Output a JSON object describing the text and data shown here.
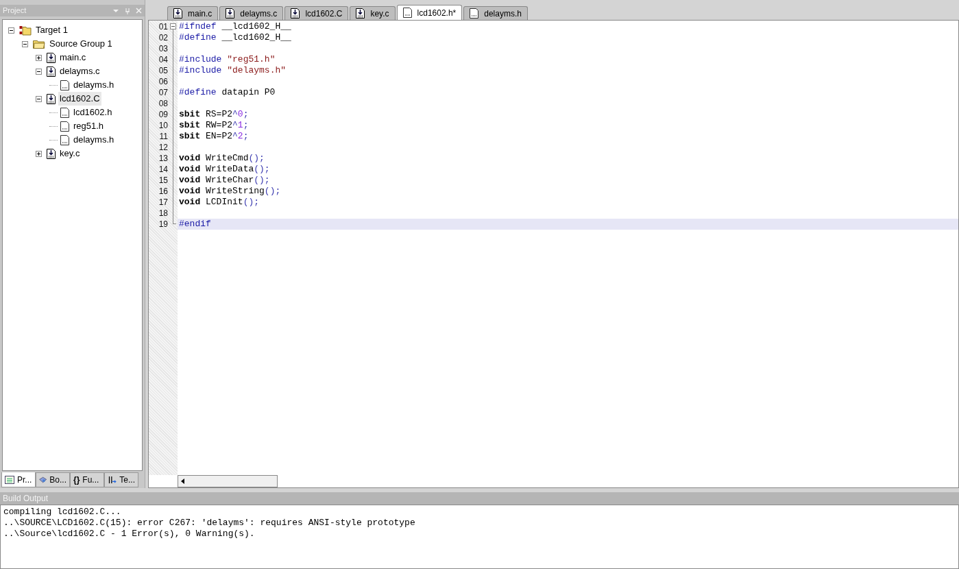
{
  "project_panel": {
    "title": "Project",
    "tree": [
      {
        "label": "Target 1",
        "kind": "target",
        "expanded": true,
        "selected": false,
        "children": [
          {
            "label": "Source Group 1",
            "kind": "folder",
            "expanded": true,
            "selected": false,
            "children": [
              {
                "label": "main.c",
                "kind": "source",
                "expanded": false,
                "selected": false
              },
              {
                "label": "delayms.c",
                "kind": "source",
                "expanded": true,
                "selected": false,
                "children": [
                  {
                    "label": "delayms.h",
                    "kind": "header",
                    "selected": false
                  }
                ]
              },
              {
                "label": "lcd1602.C",
                "kind": "source",
                "expanded": true,
                "selected": true,
                "children": [
                  {
                    "label": "lcd1602.h",
                    "kind": "header",
                    "selected": false
                  },
                  {
                    "label": "reg51.h",
                    "kind": "header",
                    "selected": false
                  },
                  {
                    "label": "delayms.h",
                    "kind": "header",
                    "selected": false
                  }
                ]
              },
              {
                "label": "key.c",
                "kind": "source",
                "expanded": false,
                "selected": false
              }
            ]
          }
        ]
      }
    ],
    "bottom_tabs": [
      {
        "label": "Pr...",
        "kind": "project",
        "selected": true
      },
      {
        "label": "Bo...",
        "kind": "books",
        "selected": false
      },
      {
        "label": "Fu...",
        "kind": "functions",
        "icon_text": "{}",
        "selected": false
      },
      {
        "label": "Te...",
        "kind": "templates",
        "selected": false
      }
    ]
  },
  "editor": {
    "tabs": [
      {
        "label": "main.c",
        "kind": "source",
        "selected": false
      },
      {
        "label": "delayms.c",
        "kind": "source",
        "selected": false
      },
      {
        "label": "lcd1602.C",
        "kind": "source",
        "selected": false
      },
      {
        "label": "key.c",
        "kind": "source",
        "selected": false
      },
      {
        "label": "lcd1602.h*",
        "kind": "header",
        "selected": true
      },
      {
        "label": "delayms.h",
        "kind": "header",
        "selected": false
      }
    ],
    "lines": [
      {
        "number": "01",
        "current": false,
        "tokens": [
          {
            "text": "#ifndef",
            "kind": "directive"
          },
          {
            "text": " __lcd1602_H__",
            "kind": "plain"
          }
        ]
      },
      {
        "number": "02",
        "current": false,
        "tokens": [
          {
            "text": "#define",
            "kind": "directive"
          },
          {
            "text": " __lcd1602_H__",
            "kind": "plain"
          }
        ]
      },
      {
        "number": "03",
        "current": false
      },
      {
        "number": "04",
        "current": false,
        "tokens": [
          {
            "text": "#include",
            "kind": "directive"
          },
          {
            "text": " \"reg51.h\"",
            "kind": "string"
          }
        ]
      },
      {
        "number": "05",
        "current": false,
        "tokens": [
          {
            "text": "#include",
            "kind": "directive"
          },
          {
            "text": " \"delayms.h\"",
            "kind": "string"
          }
        ]
      },
      {
        "number": "06",
        "current": false
      },
      {
        "number": "07",
        "current": false,
        "tokens": [
          {
            "text": "#define",
            "kind": "directive"
          },
          {
            "text": " datapin P0",
            "kind": "plain"
          }
        ]
      },
      {
        "number": "08",
        "current": false
      },
      {
        "number": "09",
        "current": false,
        "tokens": [
          {
            "text": "sbit",
            "kind": "keyword"
          },
          {
            "text": " RS=P2",
            "kind": "plain"
          },
          {
            "text": "^",
            "kind": "operator"
          },
          {
            "text": "0",
            "kind": "number"
          },
          {
            "text": ";",
            "kind": "operator"
          }
        ]
      },
      {
        "number": "10",
        "current": false,
        "tokens": [
          {
            "text": "sbit",
            "kind": "keyword"
          },
          {
            "text": " RW=P2",
            "kind": "plain"
          },
          {
            "text": "^",
            "kind": "operator"
          },
          {
            "text": "1",
            "kind": "number"
          },
          {
            "text": ";",
            "kind": "operator"
          }
        ]
      },
      {
        "number": "11",
        "current": false,
        "tokens": [
          {
            "text": "sbit",
            "kind": "keyword"
          },
          {
            "text": " EN=P2",
            "kind": "plain"
          },
          {
            "text": "^",
            "kind": "operator"
          },
          {
            "text": "2",
            "kind": "number"
          },
          {
            "text": ";",
            "kind": "operator"
          }
        ]
      },
      {
        "number": "12",
        "current": false
      },
      {
        "number": "13",
        "current": false,
        "tokens": [
          {
            "text": "void",
            "kind": "keyword"
          },
          {
            "text": " WriteCmd",
            "kind": "plain"
          },
          {
            "text": "();",
            "kind": "operator"
          }
        ]
      },
      {
        "number": "14",
        "current": false,
        "tokens": [
          {
            "text": "void",
            "kind": "keyword"
          },
          {
            "text": " WriteData",
            "kind": "plain"
          },
          {
            "text": "();",
            "kind": "operator"
          }
        ]
      },
      {
        "number": "15",
        "current": false,
        "tokens": [
          {
            "text": "void",
            "kind": "keyword"
          },
          {
            "text": " WriteChar",
            "kind": "plain"
          },
          {
            "text": "();",
            "kind": "operator"
          }
        ]
      },
      {
        "number": "16",
        "current": false,
        "tokens": [
          {
            "text": "void",
            "kind": "keyword"
          },
          {
            "text": " WriteString",
            "kind": "plain"
          },
          {
            "text": "();",
            "kind": "operator"
          }
        ]
      },
      {
        "number": "17",
        "current": false,
        "tokens": [
          {
            "text": "void",
            "kind": "keyword"
          },
          {
            "text": " LCDInit",
            "kind": "plain"
          },
          {
            "text": "();",
            "kind": "operator"
          }
        ]
      },
      {
        "number": "18",
        "current": false
      },
      {
        "number": "19",
        "current": true,
        "tokens": [
          {
            "text": "#endif",
            "kind": "directive"
          }
        ]
      }
    ]
  },
  "build_output": {
    "title": "Build Output",
    "lines": [
      "compiling lcd1602.C...",
      "..\\SOURCE\\LCD1602.C(15): error C267: 'delayms': requires ANSI-style prototype",
      "..\\Source\\lcd1602.C - 1 Error(s), 0 Warning(s)."
    ]
  }
}
